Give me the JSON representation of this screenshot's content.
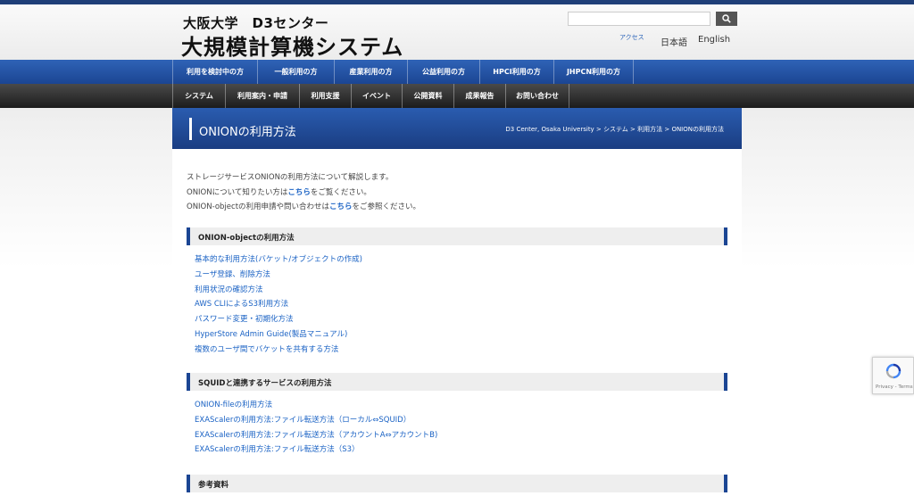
{
  "header": {
    "logo_sub": "大阪大学　D3センター",
    "logo_main": "大規模計算機システム",
    "search_placeholder": "",
    "links": {
      "access": "アクセス",
      "japanese": "日本語",
      "english": "English"
    }
  },
  "nav_primary": [
    {
      "label": "利用を検討中の方",
      "w": 96
    },
    {
      "label": "一般利用の方",
      "w": 86
    },
    {
      "label": "産業利用の方",
      "w": 82
    },
    {
      "label": "公益利用の方",
      "w": 81
    },
    {
      "label": "HPCI利用の方",
      "w": 83
    },
    {
      "label": "JHPCN利用の方",
      "w": 89
    }
  ],
  "nav_secondary": [
    {
      "label": "システム",
      "w": 60
    },
    {
      "label": "利用案内・申請",
      "w": 83
    },
    {
      "label": "利用支援",
      "w": 58
    },
    {
      "label": "イベント",
      "w": 57
    },
    {
      "label": "公開資料",
      "w": 58
    },
    {
      "label": "成果報告",
      "w": 58
    },
    {
      "label": "お問い合わせ",
      "w": 71
    }
  ],
  "page": {
    "title": "ONIONの利用方法",
    "breadcrumb": "D3 Center, Osaka University > システム > 利用方法 > ONIONの利用方法",
    "intro": {
      "line1": "ストレージサービスONIONの利用方法について解説します。",
      "line2_pre": "ONIONについて知りたい方は",
      "line2_link": "こちら",
      "line2_post": "をご覧ください。",
      "line3_pre": "ONION-objectの利用申請や問い合わせは",
      "line3_link": "こちら",
      "line3_post": "をご参照ください。"
    },
    "sections": [
      {
        "title": "ONION-objectの利用方法",
        "links": [
          "基本的な利用方法(バケット/オブジェクトの作成)",
          "ユーザ登録、削除方法",
          "利用状況の確認方法",
          "AWS CLIによるS3利用方法",
          "パスワード変更・初期化方法",
          "HyperStore Admin Guide(製品マニュアル)",
          "複数のユーザ間でバケットを共有する方法"
        ]
      },
      {
        "title": "SQUIDと連携するサービスの利用方法",
        "links": [
          "ONION-fileの利用方法",
          "EXAScalerの利用方法:ファイル転送方法（ローカル⇔SQUID）",
          "EXAScalerの利用方法:ファイル転送方法（アカウントA⇔アカウントB)",
          "EXAScalerの利用方法:ファイル転送方法（S3）"
        ]
      },
      {
        "title": "参考資料",
        "links": []
      }
    ]
  },
  "recaptcha": {
    "caption": "Privacy - Terms"
  },
  "colors": {
    "nav_blue": "#1b4593",
    "nav_dark": "#2b2b2b",
    "link": "#1a62c4"
  }
}
